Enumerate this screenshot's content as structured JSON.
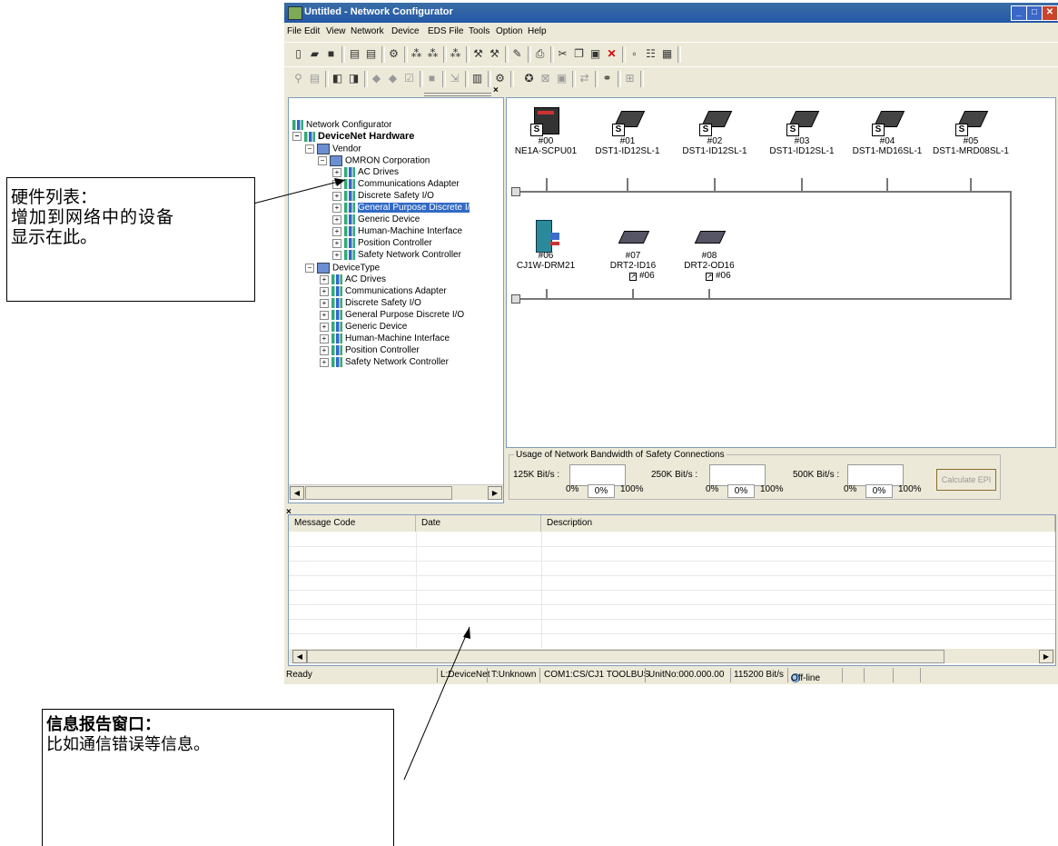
{
  "window": {
    "title": "Untitled - Network Configurator"
  },
  "menu": [
    "File",
    "Edit",
    "View",
    "Network",
    "Device",
    "EDS File",
    "Tools",
    "Option",
    "Help"
  ],
  "tree": {
    "root": "Network Configurator",
    "hardware": "DeviceNet Hardware",
    "vendor": "Vendor",
    "omron": "OMRON Corporation",
    "vendor_items": [
      "AC Drives",
      "Communications Adapter",
      "Discrete Safety I/O",
      "General Purpose Discrete I/",
      "Generic Device",
      "Human-Machine Interface",
      "Position Controller",
      "Safety Network Controller"
    ],
    "device_type": "DeviceType",
    "type_items": [
      "AC Drives",
      "Communications Adapter",
      "Discrete Safety I/O",
      "General Purpose Discrete I/O",
      "Generic Device",
      "Human-Machine Interface",
      "Position Controller",
      "Safety Network Controller"
    ]
  },
  "devices": [
    {
      "addr": "#00",
      "model": "NE1A-SCPU01",
      "badge": "S"
    },
    {
      "addr": "#01",
      "model": "DST1-ID12SL-1",
      "badge": "S"
    },
    {
      "addr": "#02",
      "model": "DST1-ID12SL-1",
      "badge": "S"
    },
    {
      "addr": "#03",
      "model": "DST1-ID12SL-1",
      "badge": "S"
    },
    {
      "addr": "#04",
      "model": "DST1-MD16SL-1",
      "badge": "S"
    },
    {
      "addr": "#05",
      "model": "DST1-MRD08SL-1",
      "badge": "S"
    },
    {
      "addr": "#06",
      "model": "CJ1W-DRM21",
      "badge": ""
    },
    {
      "addr": "#07",
      "model": "DRT2-ID16",
      "badge": "",
      "link": "#06"
    },
    {
      "addr": "#08",
      "model": "DRT2-OD16",
      "badge": "",
      "link": "#06"
    }
  ],
  "bandwidth": {
    "title": "Usage of Network Bandwidth of Safety Connections",
    "rates": [
      {
        "label": "125K Bit/s :",
        "min": "0%",
        "value": "0%",
        "max": "100%"
      },
      {
        "label": "250K Bit/s :",
        "min": "0%",
        "value": "0%",
        "max": "100%"
      },
      {
        "label": "500K Bit/s :",
        "min": "0%",
        "value": "0%",
        "max": "100%"
      }
    ],
    "calc_button": "Calculate EPI"
  },
  "messages": {
    "columns": [
      "Message Code",
      "Date",
      "Description"
    ]
  },
  "status": {
    "ready": "Ready",
    "network": "L:DeviceNet",
    "type": "T:Unknown",
    "port": "COM1:CS/CJ1 TOOLBUS",
    "unit": "UnitNo:000.000.00",
    "baud": "115200 Bit/s",
    "mode": "Off-line"
  },
  "annotations": {
    "hardware_list_title": "硬件列表：",
    "hardware_list_line1": "增加到网络中的设备",
    "hardware_list_line2": "显示在此。",
    "message_window_title": "信息报告窗口：",
    "message_window_body": "比如通信错误等信息。"
  }
}
